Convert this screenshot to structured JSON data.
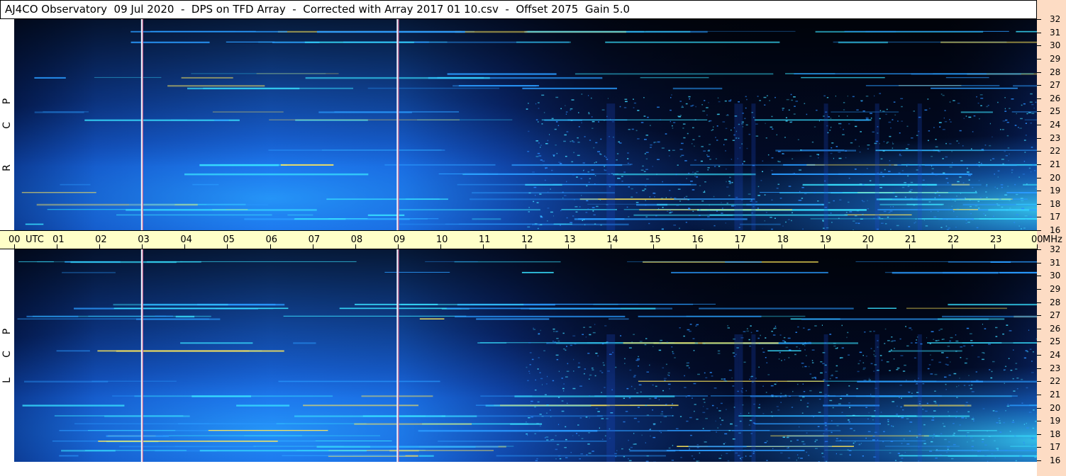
{
  "title": "AJ4CO Observatory  09 Jul 2020  -  DPS on TFD Array  -  Corrected with Array 2017 01 10.csv  -  Offset 2075  Gain 5.0",
  "panels": [
    {
      "label_letters": [
        "R",
        "C",
        "P"
      ]
    },
    {
      "label_letters": [
        "L",
        "C",
        "P"
      ]
    }
  ],
  "time_axis": {
    "ticks": [
      "00",
      "01",
      "02",
      "03",
      "04",
      "05",
      "06",
      "07",
      "08",
      "09",
      "10",
      "11",
      "12",
      "13",
      "14",
      "15",
      "16",
      "17",
      "18",
      "19",
      "20",
      "21",
      "22",
      "23",
      "00"
    ],
    "unit_left": "UTC",
    "unit_right": "MHz"
  },
  "colors": {
    "background": "#010a24",
    "axis_band": "#ffffc8",
    "freq_strip": "#fddcc4",
    "bright_blue": "#1f8cff",
    "cyan": "#29e0ff",
    "deep_blue": "#0a2a8a"
  },
  "chart_data": {
    "type": "heatmap",
    "title": "AJ4CO Observatory  09 Jul 2020  -  DPS on TFD Array  -  Corrected with Array 2017 01 10.csv  -  Offset 2075  Gain 5.0",
    "xlabel": "UTC",
    "ylabel": "MHz",
    "x_range": [
      0,
      24
    ],
    "y_range": [
      16,
      32
    ],
    "y_ticks": [
      32,
      31,
      30,
      29,
      28,
      27,
      26,
      25,
      24,
      23,
      22,
      21,
      20,
      19,
      18,
      17,
      16
    ],
    "x_ticks": [
      "00",
      "01",
      "02",
      "03",
      "04",
      "05",
      "06",
      "07",
      "08",
      "09",
      "10",
      "11",
      "12",
      "13",
      "14",
      "15",
      "16",
      "17",
      "18",
      "19",
      "20",
      "21",
      "22",
      "23",
      "00"
    ],
    "panels": [
      "RCP",
      "LCP"
    ],
    "vertical_markers_utc": [
      3.0,
      9.0
    ]
  }
}
